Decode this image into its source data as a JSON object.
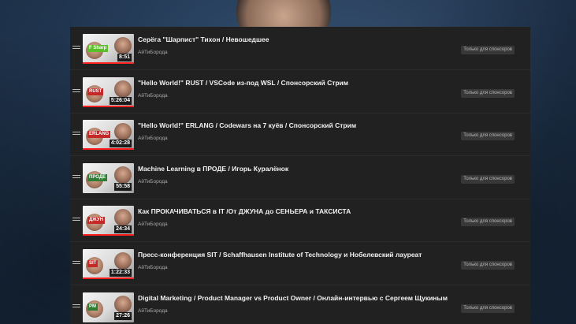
{
  "playlist": {
    "items": [
      {
        "title": "Серёга \"Шарпист\" Тихон / Невошедшее",
        "channel": "АйТиБорода",
        "duration": "8:51",
        "badge": "Только для спонсоров",
        "watched_fraction": 1.0,
        "thumb_text": "F Sharp",
        "thumb_color": "#5bbf2a"
      },
      {
        "title": "\"Hello World!\" RUST / VSCode из-под WSL / Спонсорский Стрим",
        "channel": "АйТиБорода",
        "duration": "5:26:04",
        "badge": "Только для спонсоров",
        "watched_fraction": 1.0,
        "thumb_text": "RUST",
        "thumb_color": "#c62828"
      },
      {
        "title": "\"Hello World!\" ERLANG / Codewars на 7 куёв / Спонсорский Стрим",
        "channel": "АйТиБорода",
        "duration": "4:02:28",
        "badge": "Только для спонсоров",
        "watched_fraction": 1.0,
        "thumb_text": "ERLANG",
        "thumb_color": "#c62828"
      },
      {
        "title": "Machine Learning в ПРОДЕ / Игорь Куралёнок",
        "channel": "АйТиБорода",
        "duration": "55:58",
        "badge": "Только для спонсоров",
        "watched_fraction": 0.0,
        "thumb_text": "ПРОДЕ",
        "thumb_color": "#2e7d32"
      },
      {
        "title": "Как ПРОКАЧИВАТЬСЯ в IT /От ДЖУНА до СЕНЬЕРА и ТАКСИСТА",
        "channel": "АйТиБорода",
        "duration": "24:34",
        "badge": "Только для спонсоров",
        "watched_fraction": 1.0,
        "thumb_text": "ДЖУН",
        "thumb_color": "#c62828"
      },
      {
        "title": "Пресс-конференция SIT / Schaffhausen Institute of Technology и Нобелевский лауреат",
        "channel": "АйТиБорода",
        "duration": "1:22:33",
        "badge": "Только для спонсоров",
        "watched_fraction": 1.0,
        "thumb_text": "SIT",
        "thumb_color": "#c62828"
      },
      {
        "title": "Digital Marketing / Product Manager vs Product Owner / Онлайн-интервью с Сергеем Щукиным",
        "channel": "АйТиБорода",
        "duration": "27:26",
        "badge": "Только для спонсоров",
        "watched_fraction": 0.0,
        "thumb_text": "PM",
        "thumb_color": "#2e7d32"
      }
    ]
  }
}
